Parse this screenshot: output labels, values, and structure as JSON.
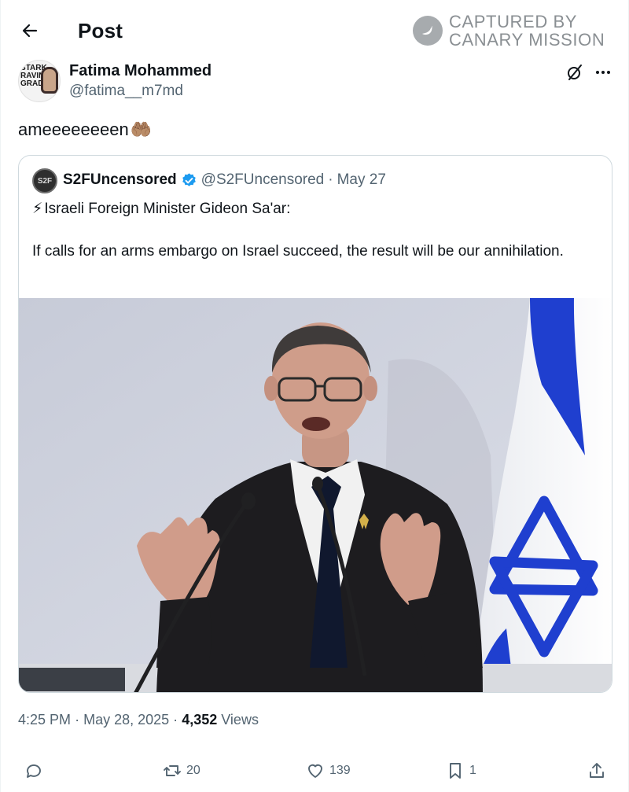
{
  "header": {
    "title": "Post"
  },
  "watermark": {
    "line1": "CAPTURED BY",
    "line2": "CANARY MISSION"
  },
  "author": {
    "name": "Fatima Mohammed",
    "handle": "@fatima__m7md",
    "avatar_text": "STARK RAVING GRAD"
  },
  "post": {
    "text": "ameeeeeeeen",
    "emoji": "🤲🏽"
  },
  "quote": {
    "avatar_text": "S2F",
    "name": "S2FUncensored",
    "handle": "@S2FUncensored",
    "separator": "·",
    "date": "May 27",
    "line1_emoji": "⚡",
    "line1": "Israeli Foreign Minister Gideon Sa'ar:",
    "line2": "If calls for an arms embargo on Israel succeed, the result will be our annihilation."
  },
  "meta": {
    "time": "4:25 PM",
    "date": "May 28, 2025",
    "views_count": "4,352",
    "views_label": "Views",
    "separator": "·"
  },
  "actions": {
    "reposts": "20",
    "likes": "139",
    "bookmarks": "1"
  },
  "colors": {
    "verified": "#1d9bf0",
    "secondary_text": "#536471",
    "flag_blue": "#1f3fcf"
  }
}
